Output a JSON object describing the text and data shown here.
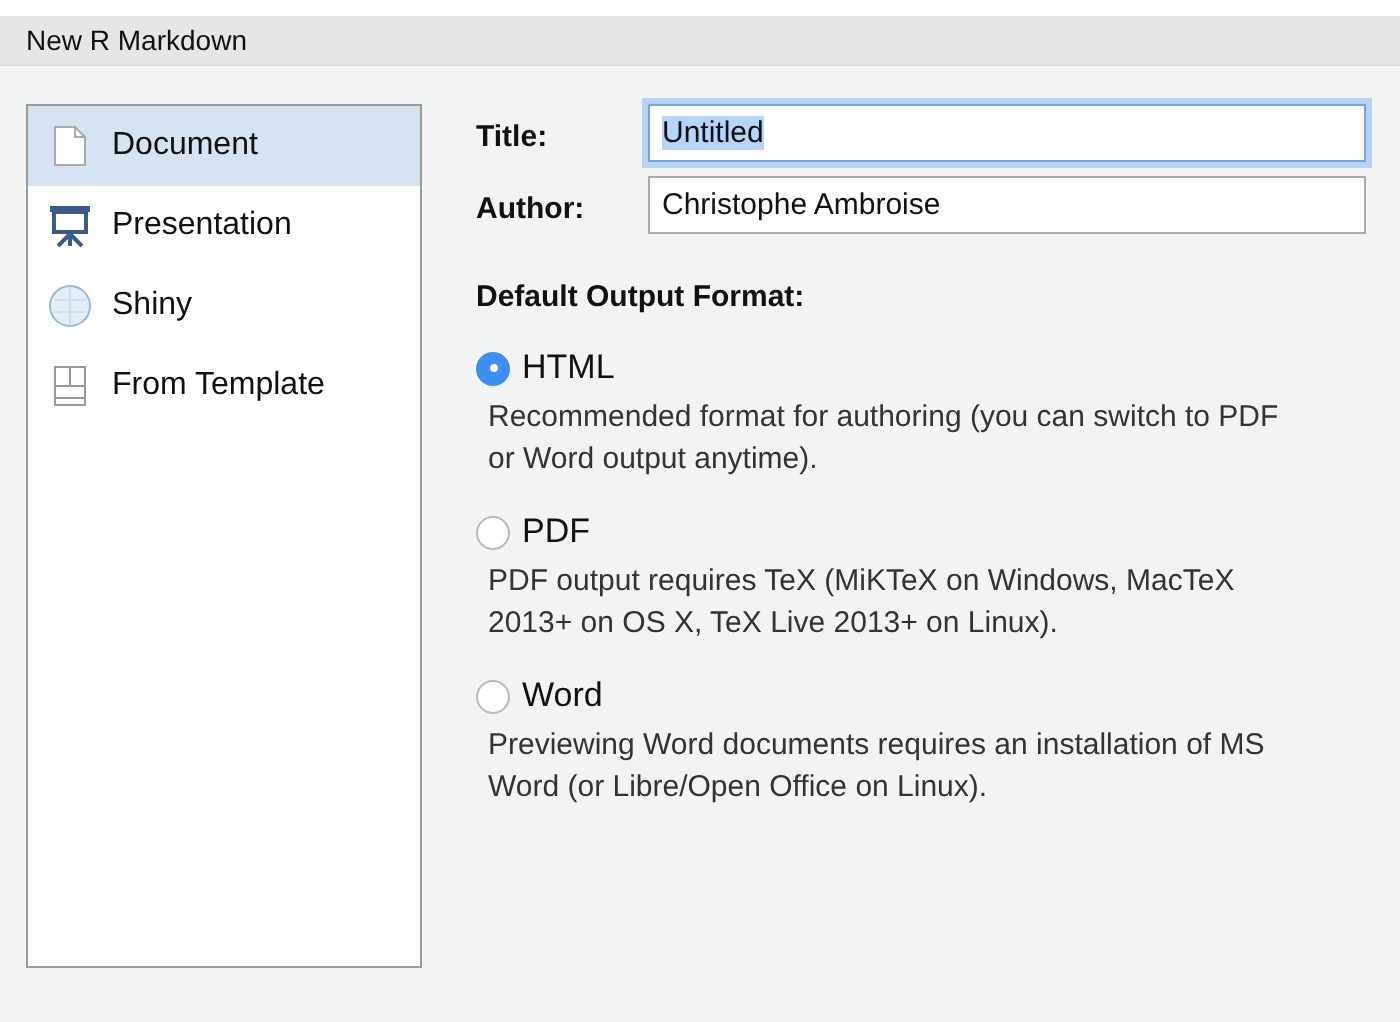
{
  "window": {
    "title": "New R Markdown"
  },
  "sidebar": {
    "items": [
      {
        "label": "Document",
        "kind": "document",
        "selected": true
      },
      {
        "label": "Presentation",
        "kind": "presentation",
        "selected": false
      },
      {
        "label": "Shiny",
        "kind": "shiny",
        "selected": false
      },
      {
        "label": "From Template",
        "kind": "template",
        "selected": false
      }
    ]
  },
  "fields": [
    {
      "label": "Title:",
      "value": "Untitled",
      "focused": true
    },
    {
      "label": "Author:",
      "value": "Christophe Ambroise",
      "focused": false
    }
  ],
  "output_format": {
    "heading": "Default Output Format:",
    "options": [
      {
        "label": "HTML",
        "selected": true,
        "description": "Recommended format for authoring (you can switch to PDF or Word output anytime)."
      },
      {
        "label": "PDF",
        "selected": false,
        "description": "PDF output requires TeX (MiKTeX on Windows, MacTeX 2013+ on OS X, TeX Live 2013+ on Linux)."
      },
      {
        "label": "Word",
        "selected": false,
        "description": "Previewing Word documents requires an installation of MS Word (or Libre/Open Office on Linux)."
      }
    ]
  }
}
